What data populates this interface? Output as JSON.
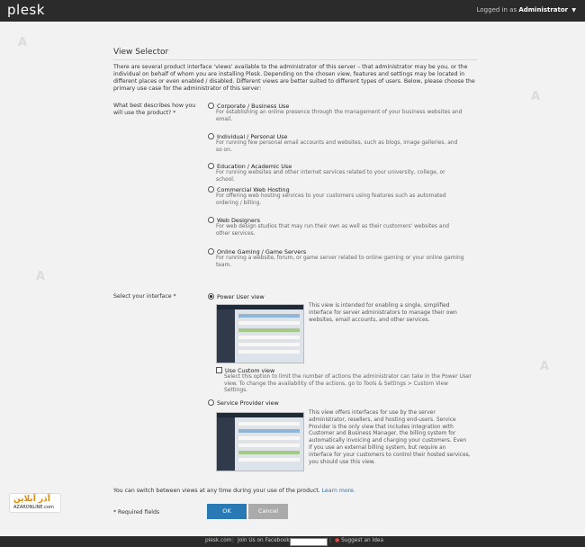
{
  "topbar": {
    "logo": "plesk",
    "login_prefix": "Logged in as",
    "login_user": "Administrator"
  },
  "page": {
    "title": "View Selector",
    "intro": "There are several product interface 'views' available to the administrator of this server – that administrator may be you, or the individual on behalf of whom you are installing Plesk. Depending on the chosen view, features and settings may be located in different places or even enabled / disabled. Different views are better suited to different types of users. Below, please choose the primary use case for the administrator of this server:"
  },
  "use_case": {
    "label": "What best describes how you will use the product? *",
    "options": [
      {
        "title": "Corporate / Business Use",
        "desc": "For establishing an online presence through the management of your business websites and email."
      },
      {
        "title": "Individual / Personal Use",
        "desc": "For running few personal email accounts and websites, such as blogs, image galleries, and so on."
      },
      {
        "title": "Education / Academic Use",
        "desc": "For running websites and other internet services related to your university, college, or school."
      },
      {
        "title": "Commercial Web Hosting",
        "desc": "For offering web hosting services to your customers using features such as automated ordering / billing."
      },
      {
        "title": "Web Designers",
        "desc": "For web design studios that may run their own as well as their customers' websites and other services."
      },
      {
        "title": "Online Gaming / Game Servers",
        "desc": "For running a website, forum, or game server related to online gaming or your online gaming team."
      }
    ]
  },
  "interface": {
    "label": "Select your interface *",
    "power_user": {
      "title": "Power User view",
      "desc": "This view is intended for enabling a single, simplified interface for server administrators to manage their own websites, email accounts, and other services."
    },
    "custom": {
      "title": "Use Custom view",
      "desc": "Select this option to limit the number of actions the administrator can take in the Power User view. To change the availability of the actions, go to Tools & Settings > Custom View Settings."
    },
    "service_provider": {
      "title": "Service Provider view",
      "desc": "This view offers interfaces for use by the server administrator, resellers, and hosting end-users. Service Provider is the only view that includes integration with Customer and Business Manager, the billing system for automatically invoicing and charging your customers. Even if you use an external billing system, but require an interface for your customers to control their hosted services, you should use this view."
    }
  },
  "switch_note": {
    "text": "You can switch between views at any time during your use of the product.",
    "link": "Learn more."
  },
  "required_note": "* Required fields",
  "buttons": {
    "ok": "OK",
    "cancel": "Cancel"
  },
  "footer": {
    "site": "plesk.com",
    "facebook": "Join Us on Facebook",
    "suggest": "Suggest an Idea"
  },
  "watermark": {
    "title": "آذر آنلاین",
    "subtitle": "AZARONLINE.com"
  }
}
